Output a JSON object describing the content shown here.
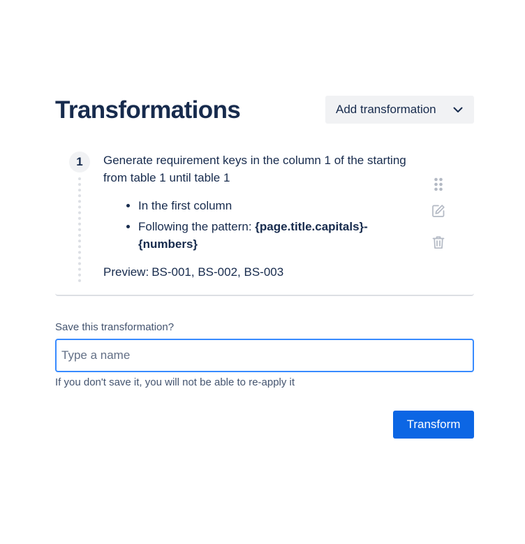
{
  "header": {
    "title": "Transformations",
    "add_button_label": "Add transformation"
  },
  "transformation": {
    "step_number": "1",
    "description": "Generate requirement keys in the column 1 of the starting from table 1 until table 1",
    "bullets": {
      "first": "In the first column",
      "pattern_prefix": "Following the pattern:",
      "pattern_value": "{page.title.capitals}-{numbers}"
    },
    "preview_label": "Preview:",
    "preview_value": "BS-001, BS-002, BS-003"
  },
  "save": {
    "label": "Save this transformation?",
    "input_placeholder": "Type a name",
    "input_value": "",
    "helper": "If you don't save it, you will not be able to re-apply it"
  },
  "actions": {
    "transform_label": "Transform"
  },
  "colors": {
    "primary": "#0c66e4",
    "input_focus_border": "#388bff",
    "text": "#172b4d",
    "subtle_text": "#44546f",
    "icon": "#b3b9c4"
  },
  "icons": [
    "chevron-down-icon",
    "drag-handle-icon",
    "edit-icon",
    "trash-icon"
  ]
}
